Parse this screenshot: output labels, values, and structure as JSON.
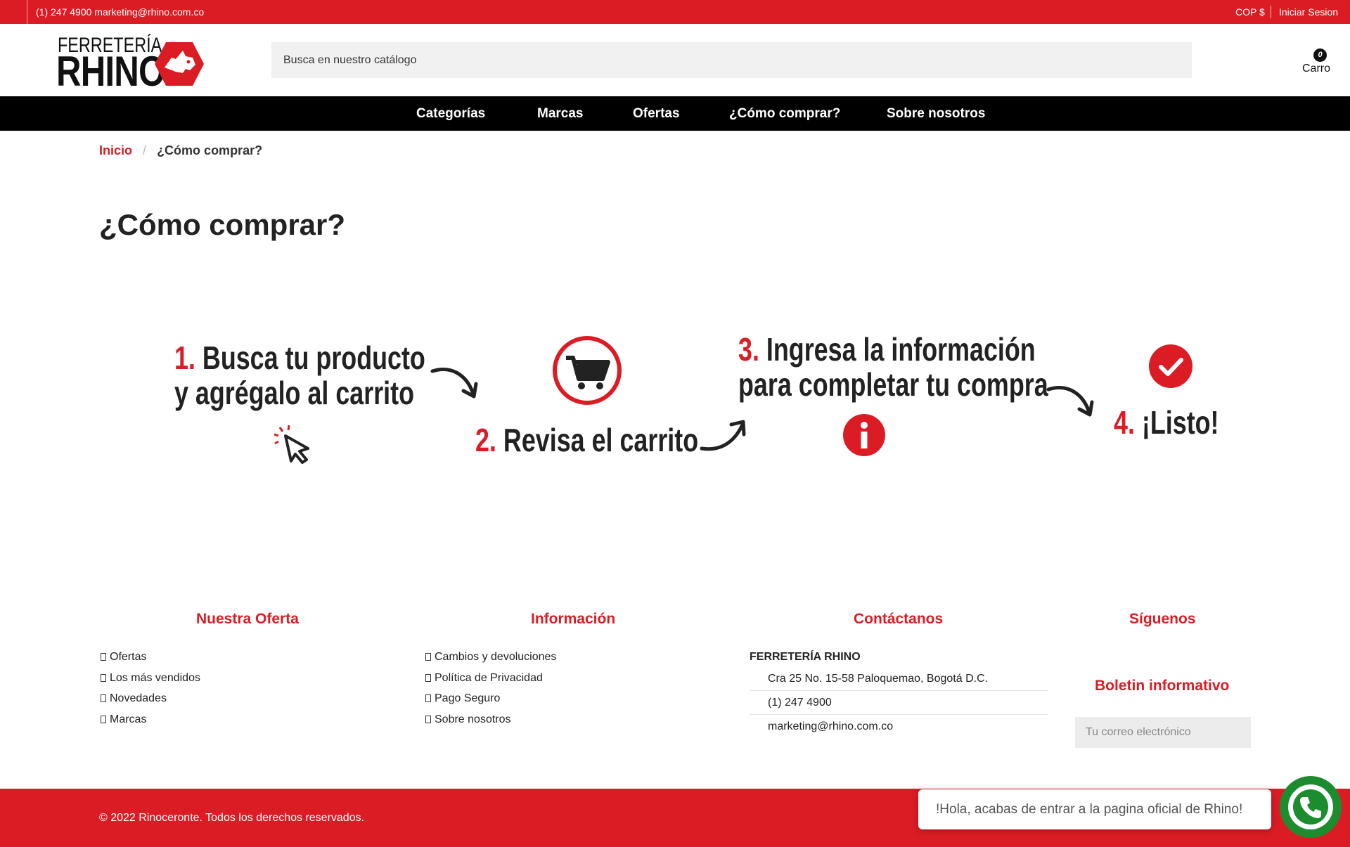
{
  "topbar": {
    "contact": "(1) 247 4900 marketing@rhino.com.co",
    "currency": "COP $",
    "login": "Iniciar Sesion"
  },
  "logo": {
    "line1": "FERRETERÍA",
    "line2": "RHINO"
  },
  "search": {
    "placeholder": "Busca en nuestro catálogo"
  },
  "cart": {
    "count": "0",
    "label": "Carro"
  },
  "nav": {
    "items": [
      {
        "label": "Categorías"
      },
      {
        "label": "Marcas"
      },
      {
        "label": "Ofertas"
      },
      {
        "label": "¿Cómo comprar?"
      },
      {
        "label": "Sobre nosotros"
      }
    ]
  },
  "breadcrumb": {
    "home": "Inicio",
    "separator": "/",
    "current": "¿Cómo comprar?"
  },
  "page": {
    "title": "¿Cómo comprar?"
  },
  "steps": {
    "s1": {
      "num": "1.",
      "line1": "Busca tu producto",
      "line2": "y agrégalo al carrito"
    },
    "s2": {
      "num": "2.",
      "text": "Revisa el carrito"
    },
    "s3": {
      "num": "3.",
      "line1": "Ingresa la información",
      "line2": "para completar tu compra"
    },
    "s4": {
      "num": "4.",
      "text": "¡Listo!"
    }
  },
  "footer": {
    "oferta": {
      "title": "Nuestra Oferta",
      "items": [
        "Ofertas",
        "Los más vendidos",
        "Novedades",
        "Marcas"
      ]
    },
    "informacion": {
      "title": "Información",
      "items": [
        "Cambios y devoluciones",
        "Política de Privacidad",
        "Pago Seguro",
        "Sobre nosotros"
      ]
    },
    "contacto": {
      "title": "Contáctanos",
      "company": "FERRETERÍA RHINO",
      "address": "Cra 25 No. 15-58 Paloquemao, Bogotá D.C.",
      "phone": "(1) 247 4900",
      "email": "marketing@rhino.com.co"
    },
    "siguenos": {
      "title": "Síguenos"
    },
    "newsletter": {
      "title": "Boletin informativo",
      "placeholder": "Tu correo electrónico"
    }
  },
  "bottombar": {
    "copyright": "© 2022 Rinoceronte. Todos los derechos reservados."
  },
  "chat": {
    "message": "!Hola, acabas de entrar a la pagina oficial de Rhino!"
  },
  "colors": {
    "brand_red": "#dc1c24",
    "nav_black": "#000000",
    "whatsapp_green": "#1b8d2e"
  }
}
